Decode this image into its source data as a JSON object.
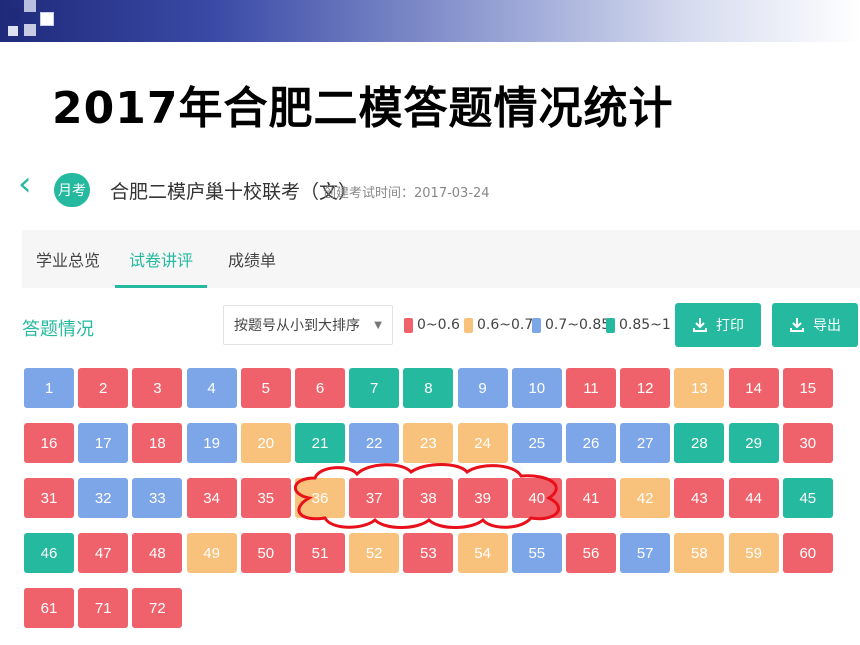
{
  "slide": {
    "title": "2017年合肥二模答题情况统计"
  },
  "exam": {
    "type_badge": "月考",
    "title": "合肥二模庐巢十校联考（文）",
    "created": "创建考试时间：2017-03-24"
  },
  "tabs": [
    {
      "label": "学业总览",
      "active": false
    },
    {
      "label": "试卷讲评",
      "active": true
    },
    {
      "label": "成绩单",
      "active": false
    }
  ],
  "section": {
    "title": "答题情况"
  },
  "sort": {
    "selected": "按题号从小到大排序"
  },
  "legend": [
    {
      "label": "0~0.6",
      "color": "#f0626b"
    },
    {
      "label": "0.6~0.7",
      "color": "#f9c27c"
    },
    {
      "label": "0.7~0.85",
      "color": "#7da6e8"
    },
    {
      "label": "0.85~1",
      "color": "#25b99f"
    }
  ],
  "buttons": {
    "print": "打印",
    "export": "导出"
  },
  "questions": [
    {
      "label": "1",
      "level": "blue"
    },
    {
      "label": "2",
      "level": "red"
    },
    {
      "label": "3",
      "level": "red"
    },
    {
      "label": "4",
      "level": "blue"
    },
    {
      "label": "5",
      "level": "red"
    },
    {
      "label": "6",
      "level": "red"
    },
    {
      "label": "7",
      "level": "green"
    },
    {
      "label": "8",
      "level": "green"
    },
    {
      "label": "9",
      "level": "blue"
    },
    {
      "label": "10",
      "level": "blue"
    },
    {
      "label": "11",
      "level": "red"
    },
    {
      "label": "12",
      "level": "red"
    },
    {
      "label": "13",
      "level": "orange"
    },
    {
      "label": "14",
      "level": "red"
    },
    {
      "label": "15",
      "level": "red"
    },
    {
      "label": "16",
      "level": "red"
    },
    {
      "label": "17",
      "level": "blue"
    },
    {
      "label": "18",
      "level": "red"
    },
    {
      "label": "19",
      "level": "blue"
    },
    {
      "label": "20",
      "level": "orange"
    },
    {
      "label": "21",
      "level": "green"
    },
    {
      "label": "22",
      "level": "blue"
    },
    {
      "label": "23",
      "level": "orange"
    },
    {
      "label": "24",
      "level": "orange"
    },
    {
      "label": "25",
      "level": "blue"
    },
    {
      "label": "26",
      "level": "blue"
    },
    {
      "label": "27",
      "level": "blue"
    },
    {
      "label": "28",
      "level": "green"
    },
    {
      "label": "29",
      "level": "green"
    },
    {
      "label": "30",
      "level": "red"
    },
    {
      "label": "31",
      "level": "red"
    },
    {
      "label": "32",
      "level": "blue"
    },
    {
      "label": "33",
      "level": "blue"
    },
    {
      "label": "34",
      "level": "red"
    },
    {
      "label": "35",
      "level": "red"
    },
    {
      "label": "36",
      "level": "orange"
    },
    {
      "label": "37",
      "level": "red"
    },
    {
      "label": "38",
      "level": "red"
    },
    {
      "label": "39",
      "level": "red"
    },
    {
      "label": "40",
      "level": "red"
    },
    {
      "label": "41",
      "level": "red"
    },
    {
      "label": "42",
      "level": "orange"
    },
    {
      "label": "43",
      "level": "red"
    },
    {
      "label": "44",
      "level": "red"
    },
    {
      "label": "45",
      "level": "green"
    },
    {
      "label": "46",
      "level": "green"
    },
    {
      "label": "47",
      "level": "red"
    },
    {
      "label": "48",
      "level": "red"
    },
    {
      "label": "49",
      "level": "orange"
    },
    {
      "label": "50",
      "level": "red"
    },
    {
      "label": "51",
      "level": "red"
    },
    {
      "label": "52",
      "level": "orange"
    },
    {
      "label": "53",
      "level": "red"
    },
    {
      "label": "54",
      "level": "orange"
    },
    {
      "label": "55",
      "level": "blue"
    },
    {
      "label": "56",
      "level": "red"
    },
    {
      "label": "57",
      "level": "blue"
    },
    {
      "label": "58",
      "level": "orange"
    },
    {
      "label": "59",
      "level": "orange"
    },
    {
      "label": "60",
      "level": "red"
    },
    {
      "label": "61",
      "level": "red"
    },
    {
      "label": "71",
      "level": "red"
    },
    {
      "label": "72",
      "level": "red"
    }
  ],
  "level_colors": {
    "red": "#f0626b",
    "orange": "#f9c27c",
    "blue": "#7da6e8",
    "green": "#25b99f"
  },
  "annotation_color": "#e8101a"
}
